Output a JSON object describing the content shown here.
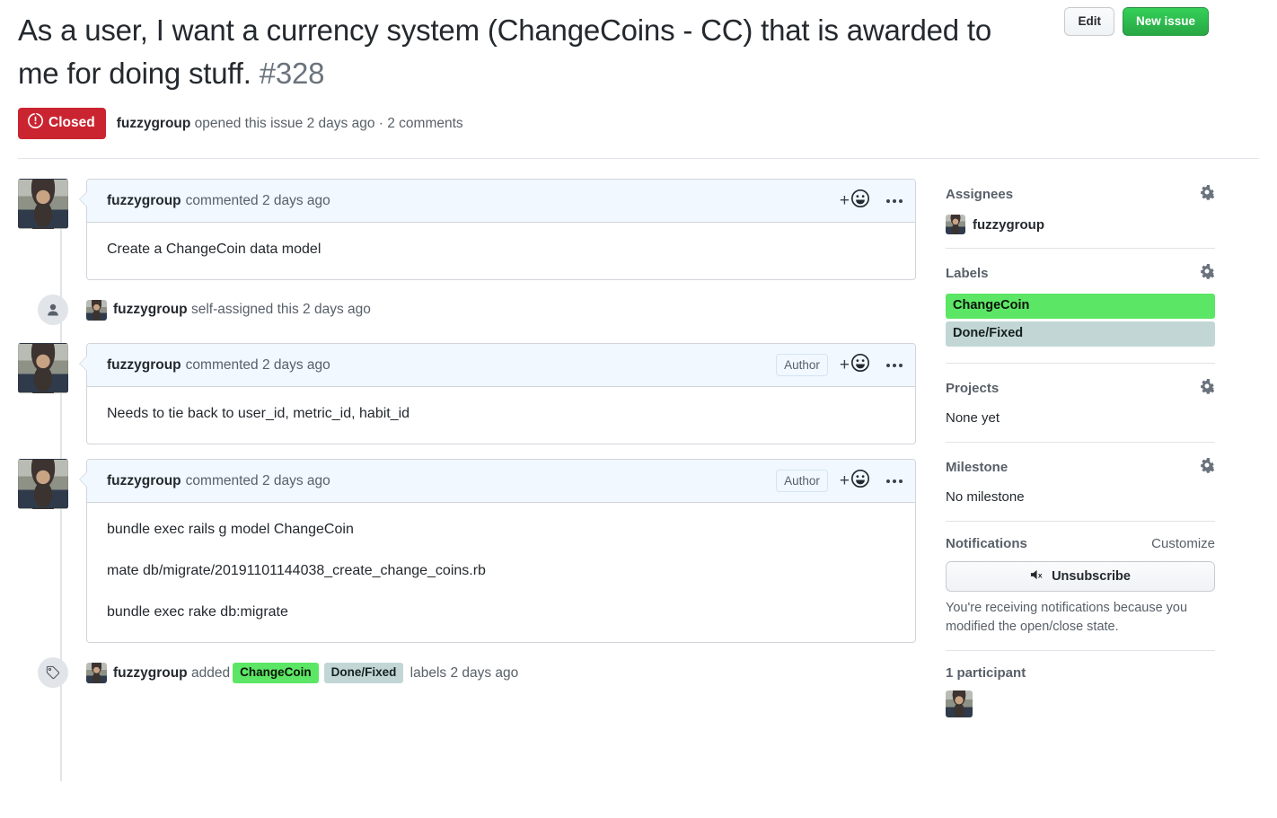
{
  "header": {
    "title": "As a user, I want a currency system (ChangeCoins - CC) that is awarded to me for doing stuff.",
    "issue_number": "#328",
    "edit_label": "Edit",
    "new_issue_label": "New issue"
  },
  "state": {
    "badge_label": "Closed",
    "badge_color": "#cb2431",
    "author": "fuzzygroup",
    "opened_text": "opened this issue 2 days ago",
    "separator": "·",
    "comments_text": "2 comments"
  },
  "timeline": [
    {
      "kind": "comment",
      "author": "fuzzygroup",
      "meta": "commented 2 days ago",
      "author_tag": "",
      "body": [
        "Create a ChangeCoin data model"
      ]
    },
    {
      "kind": "event",
      "icon": "person-icon",
      "actor": "fuzzygroup",
      "text": "self-assigned this 2 days ago"
    },
    {
      "kind": "comment",
      "author": "fuzzygroup",
      "meta": "commented 2 days ago",
      "author_tag": "Author",
      "body": [
        "Needs to tie back to user_id, metric_id, habit_id"
      ]
    },
    {
      "kind": "comment",
      "author": "fuzzygroup",
      "meta": "commented 2 days ago",
      "author_tag": "Author",
      "body": [
        "bundle exec rails g model ChangeCoin",
        "mate db/migrate/20191101144038_create_change_coins.rb",
        "bundle exec rake db:migrate"
      ]
    },
    {
      "kind": "event",
      "icon": "tag-icon",
      "actor": "fuzzygroup",
      "text_before": "added",
      "labels": [
        {
          "name": "ChangeCoin",
          "bg": "#5ce665",
          "fg": "#0b1408"
        },
        {
          "name": "Done/Fixed",
          "bg": "#c2d6d6",
          "fg": "#16211f"
        }
      ],
      "text_after": "labels 2 days ago"
    }
  ],
  "sidebar": {
    "assignees": {
      "title": "Assignees",
      "gear": "gear-icon",
      "user": "fuzzygroup"
    },
    "labels": {
      "title": "Labels",
      "gear": "gear-icon",
      "items": [
        {
          "name": "ChangeCoin",
          "bg": "#5ce665",
          "fg": "#0b1408"
        },
        {
          "name": "Done/Fixed",
          "bg": "#c2d6d6",
          "fg": "#16211f"
        }
      ]
    },
    "projects": {
      "title": "Projects",
      "gear": "gear-icon",
      "value": "None yet"
    },
    "milestone": {
      "title": "Milestone",
      "gear": "gear-icon",
      "value": "No milestone"
    },
    "notifications": {
      "title": "Notifications",
      "customize": "Customize",
      "button_label": "Unsubscribe",
      "button_icon": "mute-icon",
      "note": "You're receiving notifications because you modified the open/close state."
    },
    "participants": {
      "title": "1 participant"
    }
  },
  "reactions": {
    "add_label": "+",
    "smiley": "smiley-icon",
    "kebab": "kebab-icon"
  }
}
